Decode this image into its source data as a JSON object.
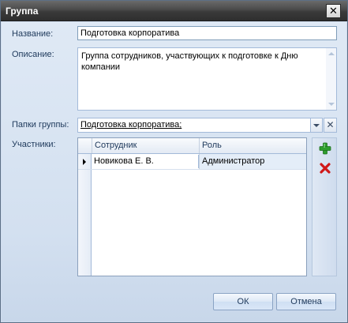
{
  "window": {
    "title": "Группа",
    "close_glyph": "✕"
  },
  "form": {
    "name_label": "Название:",
    "name_value": "Подготовка корпоратива",
    "description_label": "Описание:",
    "description_value": "Группа сотрудников, участвующих к подготовке к Дню компании",
    "folders_label": "Папки группы:",
    "folders_value": "Подготовка корпоратива;",
    "folders_clear_glyph": "✕",
    "members_label": "Участники:"
  },
  "members_grid": {
    "columns": [
      "Сотрудник",
      "Роль"
    ],
    "rows": [
      {
        "employee": "Новикова Е. В.",
        "role": "Администратор"
      }
    ],
    "ellipsis_glyph": "···"
  },
  "side_actions": {
    "add_icon": "plus-icon",
    "delete_icon": "delete-x-icon"
  },
  "buttons": {
    "ok": "ОК",
    "cancel": "Отмена"
  },
  "colors": {
    "add": "#2e9e2e",
    "delete": "#d01818"
  }
}
